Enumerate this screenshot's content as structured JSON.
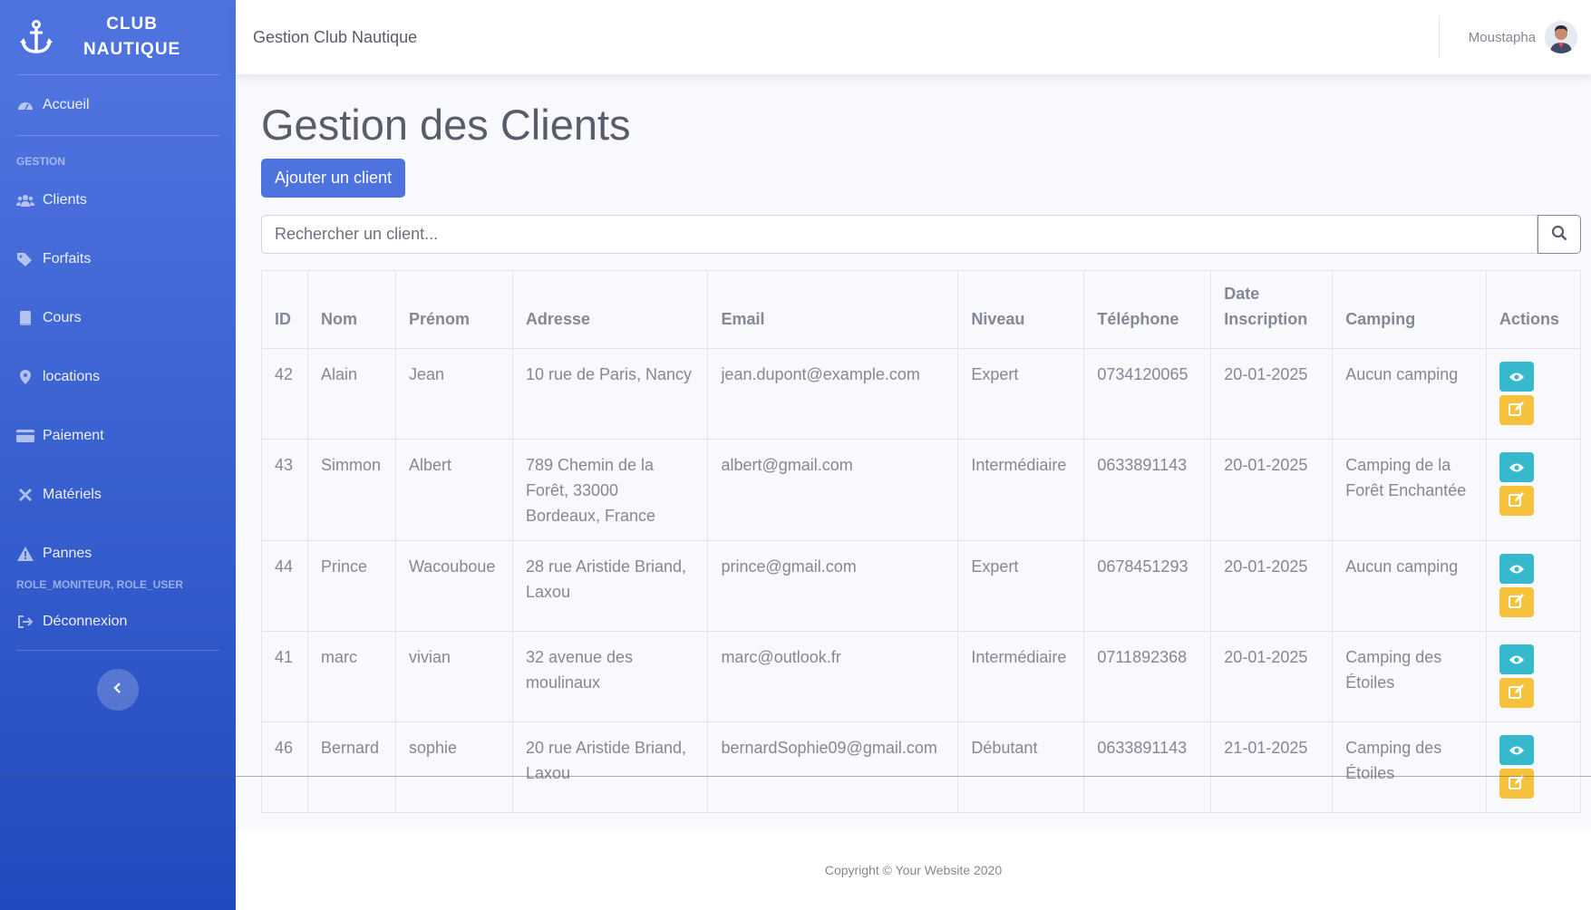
{
  "sidebar": {
    "brand_line1": "CLUB",
    "brand_line2": "NAUTIQUE",
    "brand_icon": "anchor-icon",
    "home": {
      "label": "Accueil",
      "icon": "tachometer-icon"
    },
    "heading_gestion": "GESTION",
    "items": [
      {
        "label": "Clients",
        "icon": "users-icon"
      },
      {
        "label": "Forfaits",
        "icon": "tags-icon"
      },
      {
        "label": "Cours",
        "icon": "book-icon"
      },
      {
        "label": "locations",
        "icon": "map-marker-icon"
      },
      {
        "label": "Paiement",
        "icon": "credit-card-icon"
      },
      {
        "label": "Matériels",
        "icon": "tools-icon"
      },
      {
        "label": "Pannes",
        "icon": "warning-icon"
      }
    ],
    "heading_roles": "ROLE_MONITEUR, ROLE_USER",
    "logout": {
      "label": "Déconnexion",
      "icon": "sign-out-icon"
    }
  },
  "topbar": {
    "title": "Gestion Club Nautique",
    "user_name": "Moustapha"
  },
  "main": {
    "title": "Gestion des Clients",
    "add_button": "Ajouter un client",
    "search_placeholder": "Rechercher un client...",
    "columns": [
      "ID",
      "Nom",
      "Prénom",
      "Adresse",
      "Email",
      "Niveau",
      "Téléphone",
      "Date Inscription",
      "Camping",
      "Actions"
    ],
    "rows": [
      {
        "id": "42",
        "nom": "Alain",
        "prenom": "Jean",
        "adresse": "10 rue de Paris, Nancy",
        "email": "jean.dupont@example.com",
        "niveau": "Expert",
        "telephone": "0734120065",
        "date": "20-01-2025",
        "camping": "Aucun camping"
      },
      {
        "id": "43",
        "nom": "Simmon",
        "prenom": "Albert",
        "adresse": "789 Chemin de la Forêt, 33000 Bordeaux, France",
        "email": "albert@gmail.com",
        "niveau": "Intermédiaire",
        "telephone": "0633891143",
        "date": "20-01-2025",
        "camping": "Camping de la Forêt Enchantée"
      },
      {
        "id": "44",
        "nom": "Prince",
        "prenom": "Wacouboue",
        "adresse": "28 rue Aristide Briand, Laxou",
        "email": "prince@gmail.com",
        "niveau": "Expert",
        "telephone": "0678451293",
        "date": "20-01-2025",
        "camping": "Aucun camping"
      },
      {
        "id": "41",
        "nom": "marc",
        "prenom": "vivian",
        "adresse": "32 avenue des moulinaux",
        "email": "marc@outlook.fr",
        "niveau": "Intermédiaire",
        "telephone": "0711892368",
        "date": "20-01-2025",
        "camping": "Camping des Étoiles"
      },
      {
        "id": "46",
        "nom": "Bernard",
        "prenom": "sophie",
        "adresse": "20 rue Aristide Briand, Laxou",
        "email": "bernardSophie09@gmail.com",
        "niveau": "Débutant",
        "telephone": "0633891143",
        "date": "21-01-2025",
        "camping": "Camping des Étoiles"
      }
    ]
  },
  "footer": {
    "text": "Copyright © Your Website 2020"
  },
  "colors": {
    "primary": "#4e73df",
    "info": "#36b9cc",
    "warning": "#f6c23e",
    "text": "#858796"
  }
}
